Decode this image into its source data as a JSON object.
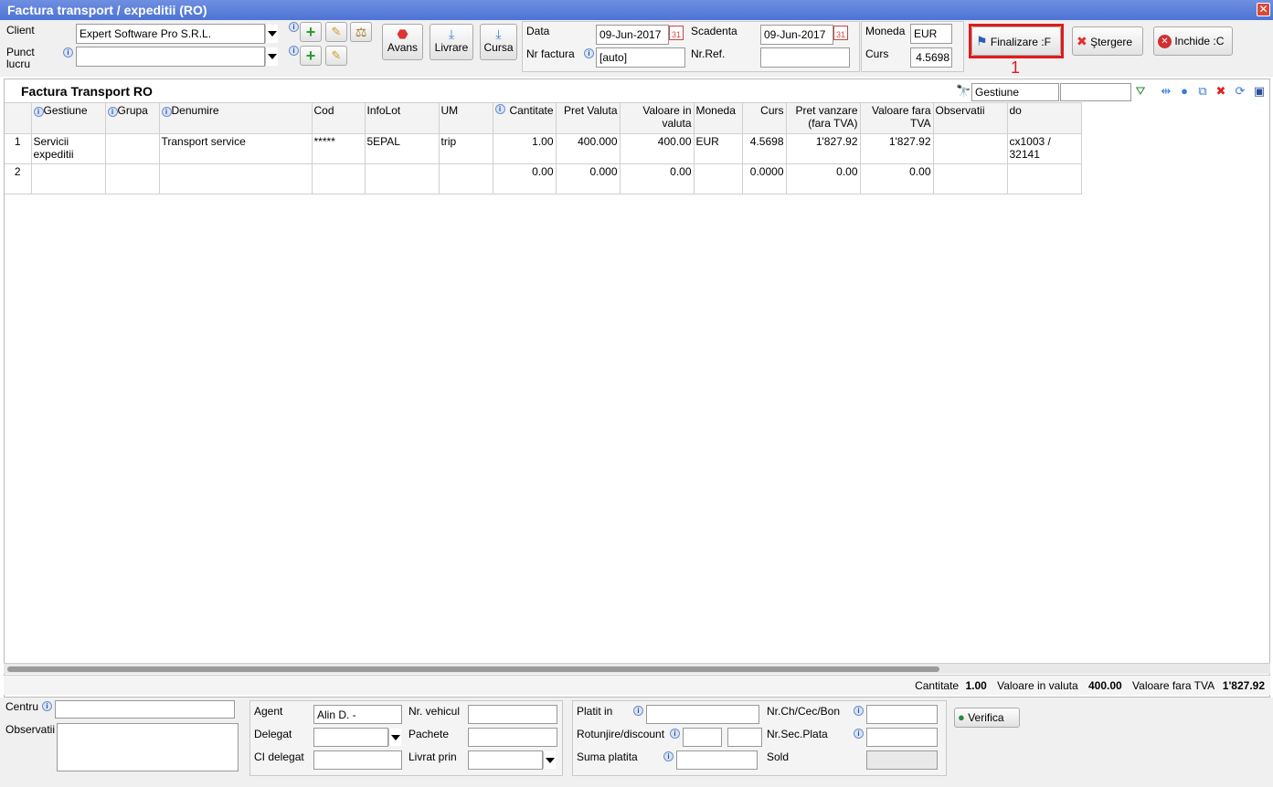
{
  "window": {
    "title": "Factura transport / expeditii (RO)"
  },
  "header": {
    "client_label": "Client",
    "client_value": "Expert Software Pro S.R.L.",
    "punct_lucru_label": "Punct lucru",
    "punct_lucru_value": "",
    "buttons": {
      "avans": "Avans",
      "livrare": "Livrare",
      "cursa": "Cursa"
    },
    "data_label": "Data",
    "data_value": "09-Jun-2017",
    "scadenta_label": "Scadenta",
    "scadenta_value": "09-Jun-2017",
    "nr_factura_label": "Nr factura",
    "nr_factura_value": "[auto]",
    "nr_ref_label": "Nr.Ref.",
    "nr_ref_value": "",
    "moneda_label": "Moneda",
    "moneda_value": "EUR",
    "curs_label": "Curs",
    "curs_value": "4.5698"
  },
  "actions": {
    "finalizare": "Finalizare :F",
    "stergere": "Ştergere",
    "inchide": "Inchide :C",
    "highlight_number": "1"
  },
  "grid": {
    "title": "Factura Transport RO",
    "gestiune_filter": "Gestiune",
    "search_value": "",
    "columns": [
      "Gestiune",
      "Grupa",
      "Denumire",
      "Cod",
      "InfoLot",
      "UM",
      "Cantitate",
      "Pret Valuta",
      "Valoare in valuta",
      "Moneda",
      "Curs",
      "Pret vanzare (fara TVA)",
      "Valoare fara TVA",
      "Observatii",
      "do"
    ],
    "rows": [
      {
        "nr": "1",
        "gestiune": "Servicii expeditii",
        "grupa": "",
        "denumire": "Transport service",
        "cod": "*****",
        "infolot": "5EPAL",
        "um": "trip",
        "cantitate": "1.00",
        "pret_valuta": "400.000",
        "valoare_valuta": "400.00",
        "moneda": "EUR",
        "curs": "4.5698",
        "pret_vanzare": "1'827.92",
        "valoare_fara_tva": "1'827.92",
        "observatii": "",
        "do": "cx1003 / 32141"
      },
      {
        "nr": "2",
        "gestiune": "",
        "grupa": "",
        "denumire": "",
        "cod": "",
        "infolot": "",
        "um": "",
        "cantitate": "0.00",
        "pret_valuta": "0.000",
        "valoare_valuta": "0.00",
        "moneda": "",
        "curs": "0.0000",
        "pret_vanzare": "0.00",
        "valoare_fara_tva": "0.00",
        "observatii": "",
        "do": ""
      }
    ]
  },
  "totals": {
    "cantitate_label": "Cantitate",
    "cantitate_value": "1.00",
    "valoare_valuta_label": "Valoare in valuta",
    "valoare_valuta_value": "400.00",
    "valoare_fara_tva_label": "Valoare fara TVA",
    "valoare_fara_tva_value": "1'827.92"
  },
  "footer": {
    "centru_label": "Centru",
    "centru_value": "",
    "observatii_label": "Observatii",
    "observatii_value": "",
    "agent_label": "Agent",
    "agent_value": "Alin D. -",
    "delegat_label": "Delegat",
    "delegat_value": "",
    "ci_delegat_label": "CI delegat",
    "ci_delegat_value": "",
    "nr_vehicul_label": "Nr. vehicul",
    "nr_vehicul_value": "",
    "pachete_label": "Pachete",
    "pachete_value": "",
    "livrat_prin_label": "Livrat prin",
    "livrat_prin_value": "",
    "platit_in_label": "Platit in",
    "platit_in_value": "",
    "rotunjire_label": "Rotunjire/discount",
    "rotunjire_value1": "",
    "rotunjire_value2": "",
    "suma_platita_label": "Suma platita",
    "suma_platita_value": "",
    "nr_ch_label": "Nr.Ch/Cec/Bon",
    "nr_ch_value": "",
    "nr_sec_label": "Nr.Sec.Plata",
    "nr_sec_value": "",
    "sold_label": "Sold",
    "sold_value": "",
    "verifica": "Verifica"
  }
}
